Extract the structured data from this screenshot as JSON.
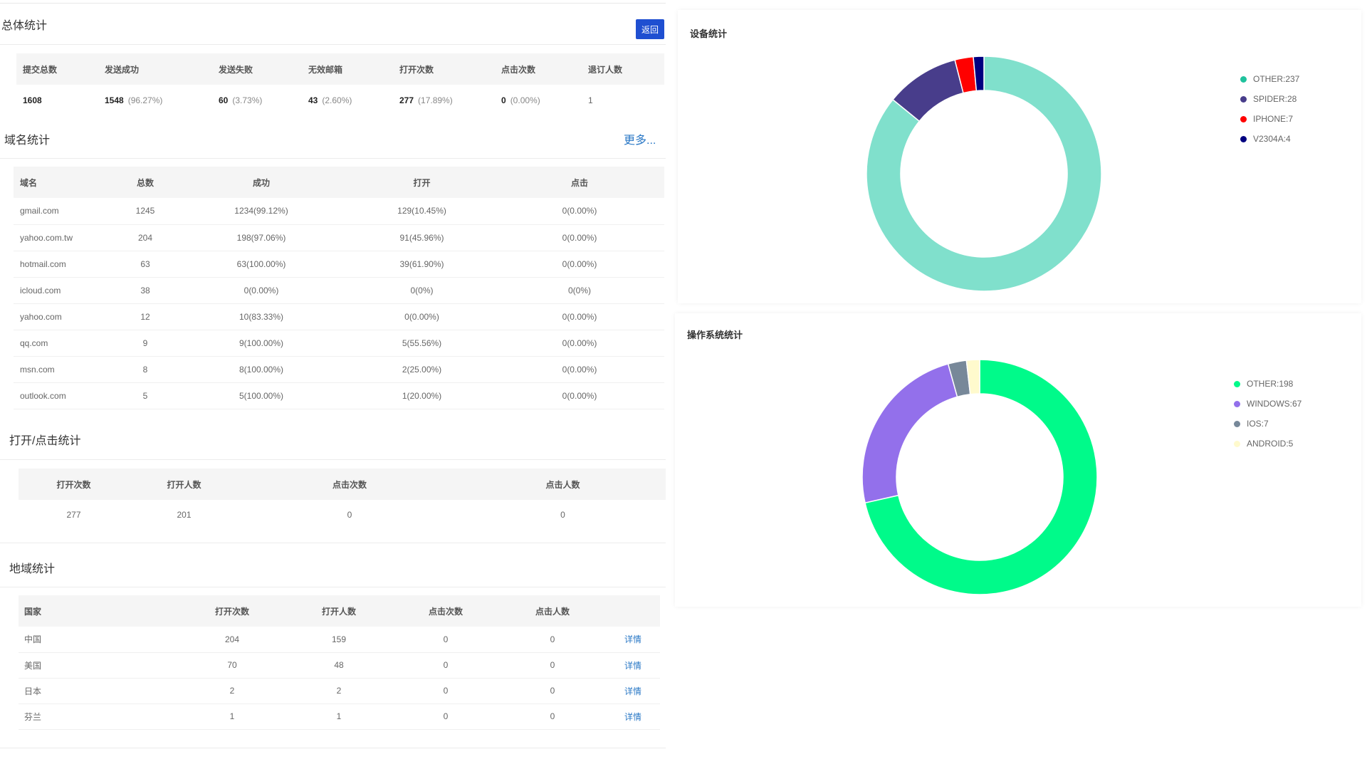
{
  "summary": {
    "title": "总体统计",
    "back_label": "返回",
    "headers": [
      "提交总数",
      "发送成功",
      "发送失败",
      "无效邮箱",
      "打开次数",
      "点击次数",
      "退订人数"
    ],
    "row": [
      {
        "value": "1608",
        "pct": ""
      },
      {
        "value": "1548",
        "pct": "(96.27%)"
      },
      {
        "value": "60",
        "pct": "(3.73%)"
      },
      {
        "value": "43",
        "pct": "(2.60%)"
      },
      {
        "value": "277",
        "pct": "(17.89%)"
      },
      {
        "value": "0",
        "pct": "(0.00%)"
      },
      {
        "value": "1",
        "pct": ""
      }
    ]
  },
  "domain": {
    "title": "域名统计",
    "more_label": "更多...",
    "headers": [
      "域名",
      "总数",
      "成功",
      "打开",
      "点击"
    ],
    "rows": [
      [
        "gmail.com",
        "1245",
        "1234(99.12%)",
        "129(10.45%)",
        "0(0.00%)"
      ],
      [
        "yahoo.com.tw",
        "204",
        "198(97.06%)",
        "91(45.96%)",
        "0(0.00%)"
      ],
      [
        "hotmail.com",
        "63",
        "63(100.00%)",
        "39(61.90%)",
        "0(0.00%)"
      ],
      [
        "icloud.com",
        "38",
        "0(0.00%)",
        "0(0%)",
        "0(0%)"
      ],
      [
        "yahoo.com",
        "12",
        "10(83.33%)",
        "0(0.00%)",
        "0(0.00%)"
      ],
      [
        "qq.com",
        "9",
        "9(100.00%)",
        "5(55.56%)",
        "0(0.00%)"
      ],
      [
        "msn.com",
        "8",
        "8(100.00%)",
        "2(25.00%)",
        "0(0.00%)"
      ],
      [
        "outlook.com",
        "5",
        "5(100.00%)",
        "1(20.00%)",
        "0(0.00%)"
      ]
    ]
  },
  "open_click": {
    "title": "打开/点击统计",
    "headers": [
      "打开次数",
      "打开人数",
      "点击次数",
      "点击人数"
    ],
    "row": [
      "277",
      "201",
      "0",
      "0"
    ]
  },
  "region": {
    "title": "地域统计",
    "headers": [
      "国家",
      "打开次数",
      "打开人数",
      "点击次数",
      "点击人数",
      ""
    ],
    "detail_label": "详情",
    "rows": [
      [
        "中国",
        "204",
        "159",
        "0",
        "0"
      ],
      [
        "美国",
        "70",
        "48",
        "0",
        "0"
      ],
      [
        "日本",
        "2",
        "2",
        "0",
        "0"
      ],
      [
        "芬兰",
        "1",
        "1",
        "0",
        "0"
      ]
    ]
  },
  "chart_data": [
    {
      "type": "pie",
      "title": "设备统计",
      "series": [
        {
          "name": "OTHER",
          "value": 237,
          "label": "OTHER:237",
          "color": "#80e0cc",
          "legend_color": "#1fc29d"
        },
        {
          "name": "SPIDER",
          "value": 28,
          "label": "SPIDER:28",
          "color": "#483d8b",
          "legend_color": "#483d8b"
        },
        {
          "name": "IPHONE",
          "value": 7,
          "label": "IPHONE:7",
          "color": "#ff0000",
          "legend_color": "#ff0000"
        },
        {
          "name": "V2304A",
          "value": 4,
          "label": "V2304A:4",
          "color": "#000080",
          "legend_color": "#000080"
        }
      ]
    },
    {
      "type": "pie",
      "title": "操作系统统计",
      "series": [
        {
          "name": "OTHER",
          "value": 198,
          "label": "OTHER:198",
          "color": "#00fa8a",
          "legend_color": "#00fa8a"
        },
        {
          "name": "WINDOWS",
          "value": 67,
          "label": "WINDOWS:67",
          "color": "#9370eb",
          "legend_color": "#9370eb"
        },
        {
          "name": "IOS",
          "value": 7,
          "label": "IOS:7",
          "color": "#778899",
          "legend_color": "#778899"
        },
        {
          "name": "ANDROID",
          "value": 5,
          "label": "ANDROID:5",
          "color": "#fffacd",
          "legend_color": "#fffacd"
        }
      ]
    }
  ]
}
